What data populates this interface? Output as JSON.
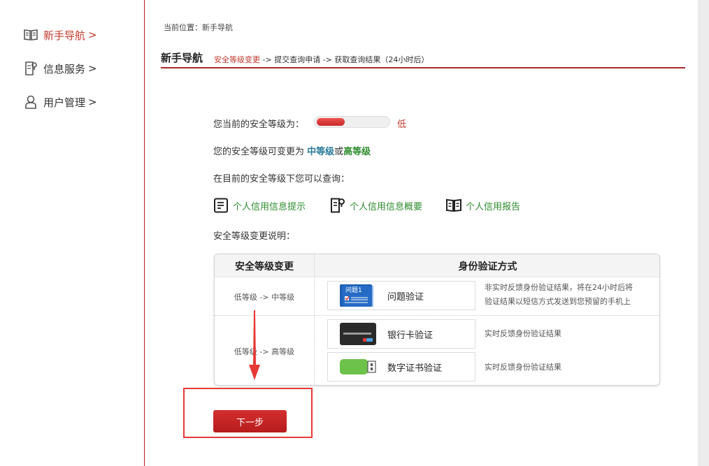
{
  "sidebar": {
    "items": [
      {
        "label": "新手导航",
        "arrow": ">",
        "icon": "open-book-icon",
        "active": true
      },
      {
        "label": "信息服务",
        "arrow": ">",
        "icon": "document-icon",
        "active": false
      },
      {
        "label": "用户管理",
        "arrow": ">",
        "icon": "user-icon",
        "active": false
      }
    ]
  },
  "breadcrumb": "当前位置：新手导航",
  "header": {
    "title": "新手导航",
    "step1": "安全等级变更",
    "sep1": " -> ",
    "step2": "提交查询申请",
    "sep2": " -> ",
    "step3": "获取查询结果（24小时后）"
  },
  "security": {
    "current_label": "您当前的安全等级为：",
    "current_value": "低",
    "level_fraction": 0.4,
    "changeable_prefix": "您的安全等级可变更为 ",
    "medium": "中等级",
    "or": "或",
    "high": "高等级",
    "query_label": "在目前的安全等级下您可以查询：",
    "explain_label": "安全等级变更说明："
  },
  "queries": [
    {
      "label": "个人信用信息提示",
      "icon": "document-lines-icon"
    },
    {
      "label": "个人信用信息概要",
      "icon": "document-tag-icon"
    },
    {
      "label": "个人信用报告",
      "icon": "open-book-icon"
    }
  ],
  "table": {
    "col1": "安全等级变更",
    "col2": "身份验证方式",
    "rows": [
      {
        "change": "低等级 -> 中等级",
        "methods": [
          {
            "label": "问题验证",
            "icon": "question-card-icon",
            "icon_text": "问题1",
            "desc1": "非实时反馈身份验证结果，将在24小时后将",
            "desc2": "验证结果以短信方式发送到您预留的手机上"
          }
        ]
      },
      {
        "change": "低等级 -> 高等级",
        "methods": [
          {
            "label": "银行卡验证",
            "icon": "bank-card-icon",
            "desc1": "实时反馈身份验证结果"
          },
          {
            "label": "数字证书验证",
            "icon": "usb-key-icon",
            "desc1": "实时反馈身份验证结果"
          }
        ]
      }
    ]
  },
  "next_button": "下一步",
  "colors": {
    "accent": "#b71c1c",
    "link_green": "#2e8b2e",
    "medium_blue": "#2a7a9a"
  }
}
